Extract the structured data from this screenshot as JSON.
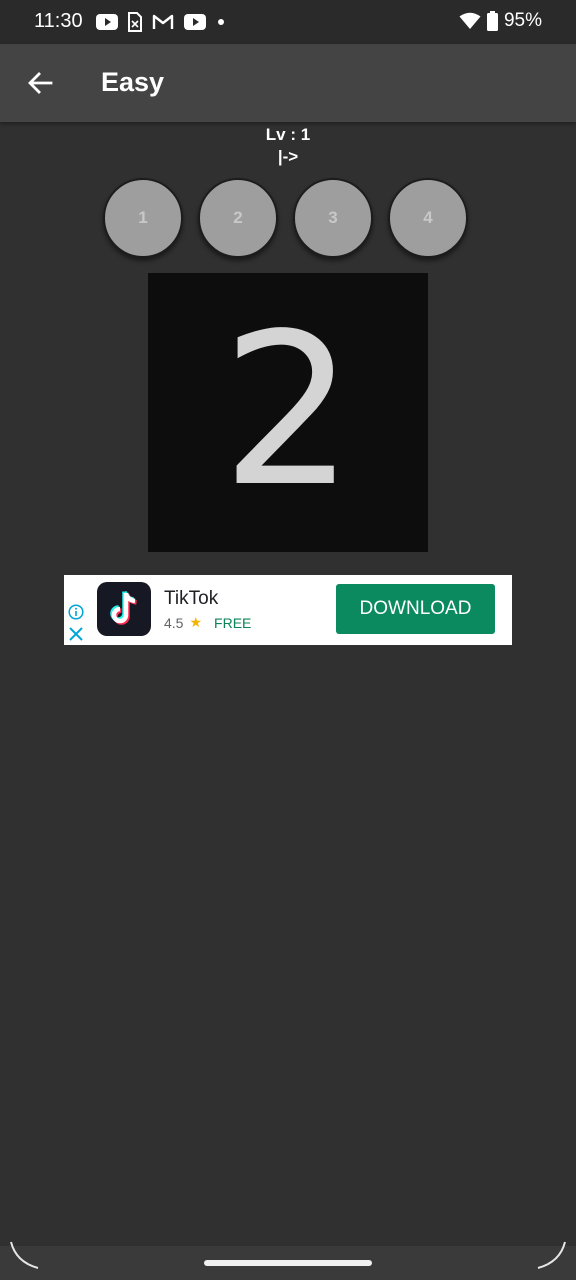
{
  "status_bar": {
    "time": "11:30",
    "notification_icons": [
      "youtube-icon",
      "sim-icon",
      "gmail-icon",
      "youtube-icon",
      "dot-icon"
    ],
    "battery": "95%"
  },
  "app_bar": {
    "title": "Easy"
  },
  "game": {
    "level_text": "Lv : 1",
    "hint_text": "|->",
    "choices": [
      "1",
      "2",
      "3",
      "4"
    ],
    "display_number": "2"
  },
  "ad": {
    "app_name": "TikTok",
    "rating": "4.5",
    "price": "FREE",
    "button_label": "DOWNLOAD"
  },
  "colors": {
    "background": "#303030",
    "app_bar": "#444444",
    "choice_button": "#9e9e9e",
    "display_bg": "#0d0d0d",
    "ad_button": "#0b8a60"
  }
}
